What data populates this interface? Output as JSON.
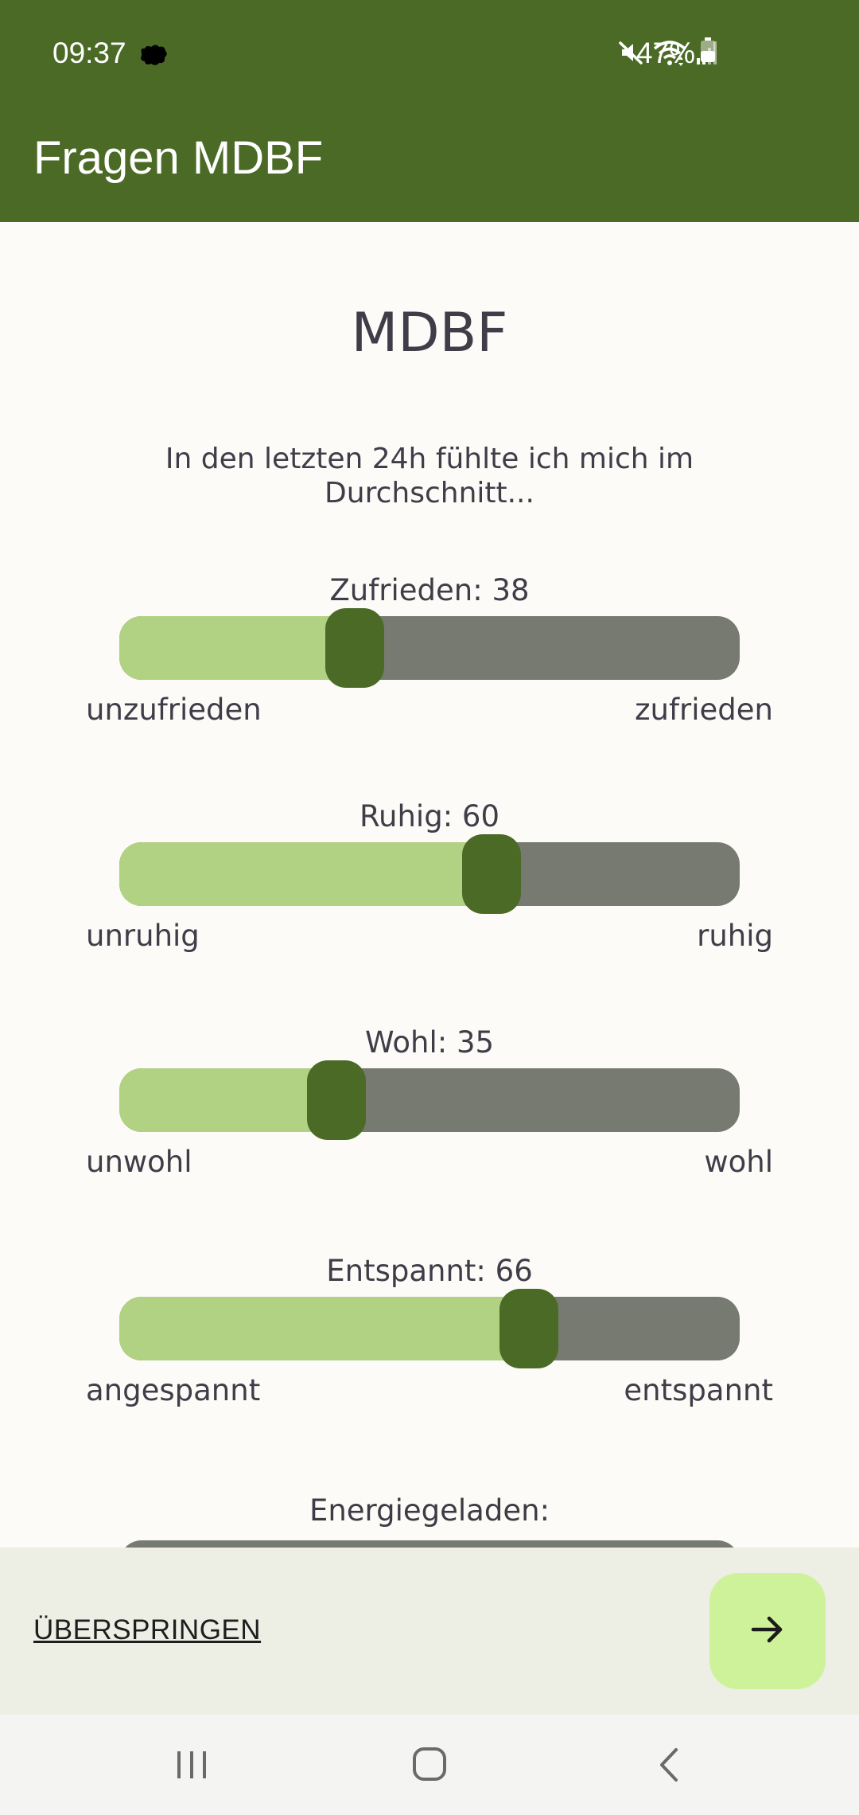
{
  "status_bar": {
    "time": "09:37",
    "battery_percent": "47%",
    "icons": [
      "creature-icon",
      "mute-icon",
      "wifi-icon",
      "signal-icon",
      "battery-icon"
    ]
  },
  "app_bar": {
    "title": "Fragen MDBF"
  },
  "page": {
    "heading": "MDBF",
    "intro": "In den letzten 24h fühlte ich mich im Durchschnitt..."
  },
  "questions": [
    {
      "label": "Zufrieden",
      "value": "38",
      "min_label": "unzufrieden",
      "max_label": "zufrieden"
    },
    {
      "label": "Ruhig",
      "value": "60",
      "min_label": "unruhig",
      "max_label": "ruhig"
    },
    {
      "label": "Wohl",
      "value": "35",
      "min_label": "unwohl",
      "max_label": "wohl"
    },
    {
      "label": "Entspannt",
      "value": "66",
      "min_label": "angespannt",
      "max_label": "entspannt"
    },
    {
      "label": "Energiegeladen",
      "value": ""
    }
  ],
  "footer": {
    "skip_label": "ÜBERSPRINGEN",
    "next_icon": "arrow-right-icon"
  },
  "colors": {
    "primary": "#4b6a26",
    "track_active": "#b0d282",
    "track_inactive": "#777a70",
    "next_button": "#cdf299",
    "background": "#fcfbf7"
  }
}
